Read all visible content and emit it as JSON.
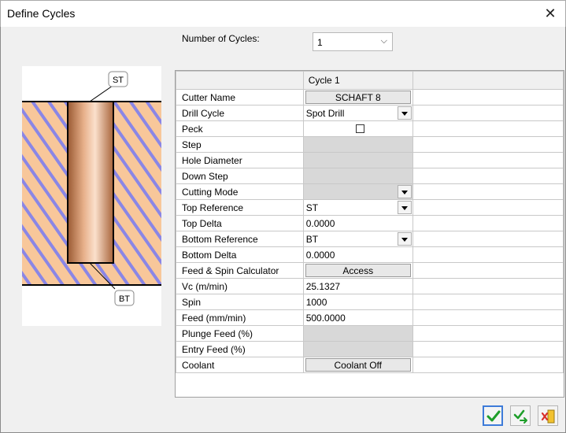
{
  "window": {
    "title": "Define Cycles",
    "close_glyph": "✕"
  },
  "cycles": {
    "label": "Number of Cycles:",
    "value": "1",
    "chevron": "⌵"
  },
  "diagram": {
    "top_label": "ST",
    "bottom_label": "BT"
  },
  "grid": {
    "column_header": "Cycle 1",
    "rows": [
      {
        "label": "Cutter Name",
        "value": "SCHAFT 8",
        "kind": "button"
      },
      {
        "label": "Drill Cycle",
        "value": "Spot Drill",
        "kind": "dropdown"
      },
      {
        "label": "Peck",
        "value": "",
        "kind": "checkbox",
        "checked": false
      },
      {
        "label": "Step",
        "value": "",
        "kind": "disabled"
      },
      {
        "label": "Hole Diameter",
        "value": "",
        "kind": "disabled"
      },
      {
        "label": "Down Step",
        "value": "",
        "kind": "disabled"
      },
      {
        "label": "Cutting Mode",
        "value": "",
        "kind": "disabled-dropdown"
      },
      {
        "label": "Top Reference",
        "value": "ST",
        "kind": "dropdown"
      },
      {
        "label": "Top Delta",
        "value": "0.0000",
        "kind": "text"
      },
      {
        "label": "Bottom Reference",
        "value": "BT",
        "kind": "dropdown"
      },
      {
        "label": "Bottom Delta",
        "value": "0.0000",
        "kind": "text"
      },
      {
        "label": "Feed & Spin Calculator",
        "value": "Access",
        "kind": "button"
      },
      {
        "label": "Vc (m/min)",
        "value": "25.1327",
        "kind": "text"
      },
      {
        "label": "Spin",
        "value": "1000",
        "kind": "text"
      },
      {
        "label": "Feed (mm/min)",
        "value": "500.0000",
        "kind": "text"
      },
      {
        "label": "Plunge Feed (%)",
        "value": "",
        "kind": "disabled"
      },
      {
        "label": "Entry Feed (%)",
        "value": "",
        "kind": "disabled"
      },
      {
        "label": "Coolant",
        "value": "Coolant Off",
        "kind": "button"
      }
    ]
  },
  "buttons": [
    {
      "name": "ok-button",
      "icon": "check-icon"
    },
    {
      "name": "apply-button",
      "icon": "check-arrow-icon"
    },
    {
      "name": "cancel-button",
      "icon": "exit-icon"
    }
  ],
  "colors": {
    "stripe_bg": "#f8c79a",
    "stripe_line": "#8a86e6",
    "tool_copper": "#d08a5c",
    "check_green": "#1e9e2a"
  }
}
